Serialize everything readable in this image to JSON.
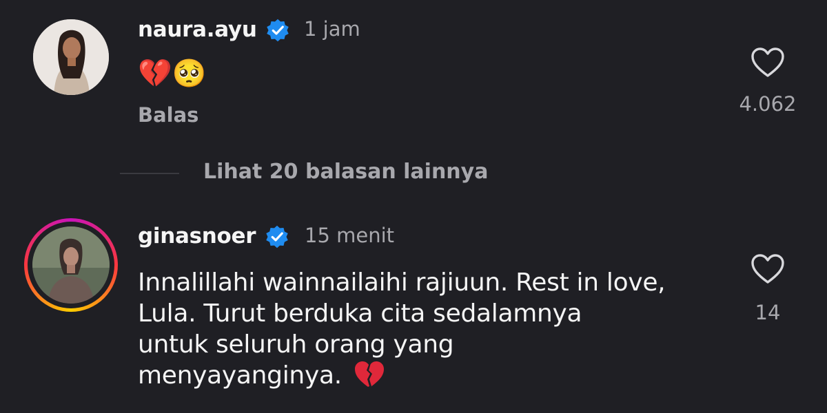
{
  "comments": [
    {
      "username": "naura.ayu",
      "verified": true,
      "time": "1 jam",
      "text": "💔🥺",
      "reply_label": "Balas",
      "likes": "4.062",
      "avatar_icon": "profile-photo"
    },
    {
      "username": "ginasnoer",
      "verified": true,
      "time": "15 menit",
      "text_lines": [
        "Innalillahi wainnailaihi rajiuun. Rest in love,",
        "Lula. Turut berduka cita sedalamnya",
        "untuk seluruh orang yang",
        "menyayanginya."
      ],
      "likes": "14",
      "avatar_icon": "profile-photo-with-story-ring"
    }
  ],
  "view_more": "Lihat 20 balasan lainnya",
  "colors": {
    "background": "#1f1f24",
    "verified_badge": "#1f8cf0",
    "secondary_text": "#a8a8ad"
  }
}
